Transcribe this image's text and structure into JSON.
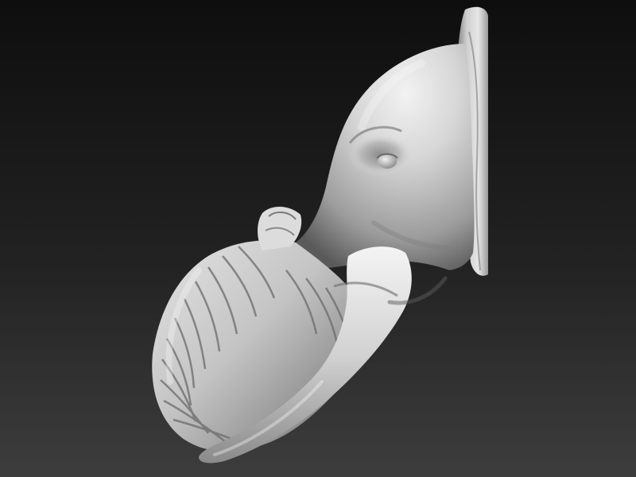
{
  "scene": {
    "subject": "elephant-head-sculpt",
    "material": "matte-clay",
    "colors": {
      "background_top": "#0e0e0e",
      "background_mid": "#222222",
      "background_bottom": "#3d3d3d",
      "clay_light": "#e8e8e8",
      "clay_mid": "#a4a4a4",
      "clay_dark": "#4a4a4a"
    }
  }
}
